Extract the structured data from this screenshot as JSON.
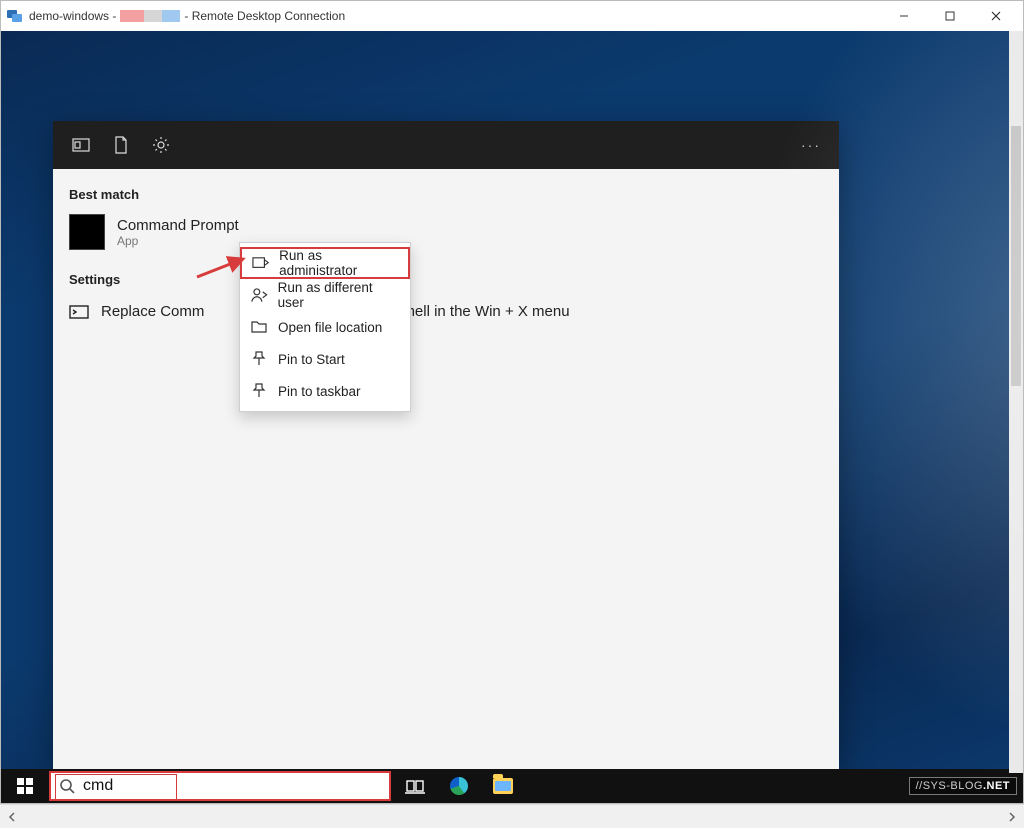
{
  "rdc": {
    "title_prefix": "demo-windows -",
    "title_suffix": "- Remote Desktop Connection"
  },
  "start": {
    "best_match_header": "Best match",
    "best_app": {
      "title": "Command Prompt",
      "subtitle": "App"
    },
    "settings_header": "Settings",
    "settings_item_pre": "Replace Comm",
    "settings_item_post": "s PowerShell in the Win + X menu"
  },
  "ctx": {
    "run_admin": "Run as administrator",
    "run_diff": "Run as different user",
    "open_loc": "Open file location",
    "pin_start": "Pin to Start",
    "pin_taskbar": "Pin to taskbar"
  },
  "taskbar": {
    "search_value": "cmd"
  },
  "watermark": {
    "prefix": "//SYS-BLOG",
    "suffix": ".NET"
  }
}
